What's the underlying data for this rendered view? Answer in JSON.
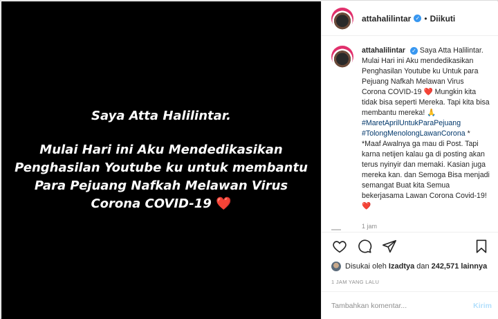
{
  "media": {
    "line1": "Saya Atta Halilintar.",
    "line2": "Mulai Hari ini Aku Mendedikasikan Penghasilan Youtube ku untuk membantu Para Pejuang Nafkah Melawan Virus Corona COVID-19",
    "heart": "❤️"
  },
  "header": {
    "username": "attahalilintar",
    "verified_glyph": "✓",
    "dot": "•",
    "follow_label": "Diikuti"
  },
  "caption": {
    "username": "attahalilintar",
    "verified_glyph": "✓",
    "text1": "Saya Atta Halilintar. Mulai Hari ini Aku mendedikasikan Penghasilan Youtube ku Untuk para Pejuang Nafkah Melawan Virus Corona COVID-19",
    "heart1": "❤️",
    "text2": "Mungkin kita tidak bisa seperti Mereka. Tapi kita bisa membantu mereka!",
    "pray": "🙏",
    "hashtag1": "#MaretAprilUntukParaPejuang",
    "hashtag2": "#TolongMenolongLawanCorona",
    "star": "*",
    "text3": "*Maaf Awalnya ga mau di Post. Tapi karna netijen kalau ga di posting akan terus nyinyir dan memaki. Kasian juga mereka kan. dan Semoga Bisa menjadi semangat Buat kita Semua bekerjasama Lawan Corona Covid-19!",
    "heart2": "❤️",
    "time": "1 jam"
  },
  "actions": {
    "like_icon": "heart-icon",
    "comment_icon": "comment-icon",
    "share_icon": "share-icon",
    "save_icon": "bookmark-icon"
  },
  "likes": {
    "prefix": "Disukai oleh",
    "user": "Izadtya",
    "and": "dan",
    "count": "242,571",
    "suffix": "lainnya"
  },
  "timestamp": "1 JAM YANG LALU",
  "comment": {
    "placeholder": "Tambahkan komentar...",
    "post_label": "Kirim"
  },
  "colors": {
    "accent": "#3897f0",
    "heart": "#ed4956",
    "hashtag": "#00376b",
    "post_disabled": "#b2dffc"
  }
}
